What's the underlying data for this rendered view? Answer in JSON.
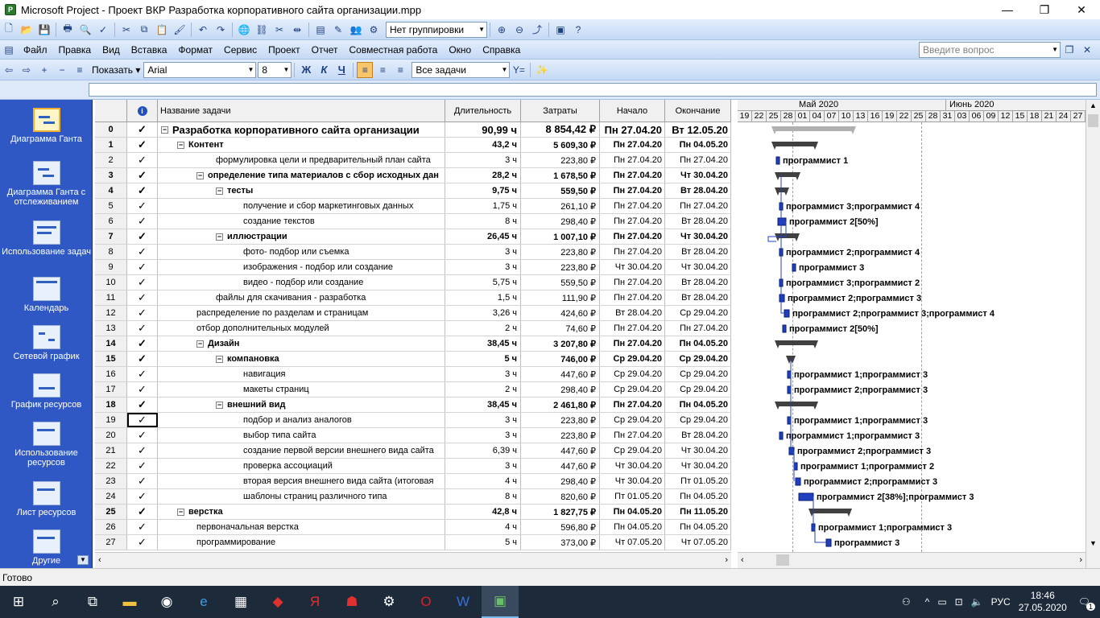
{
  "window": {
    "title": "Microsoft Project - Проект ВКР Разработка корпоративного сайта организации.mpp",
    "minimize": "—",
    "maximize": "❐",
    "close": "✕"
  },
  "toolbar1": {
    "grouping": "Нет группировки"
  },
  "menu": {
    "items": [
      "Файл",
      "Правка",
      "Вид",
      "Вставка",
      "Формат",
      "Сервис",
      "Проект",
      "Отчет",
      "Совместная работа",
      "Окно",
      "Справка"
    ],
    "help_placeholder": "Введите вопрос"
  },
  "toolbar3": {
    "show_label": "Показать",
    "font": "Arial",
    "size": "8",
    "bold": "Ж",
    "italic": "К",
    "underline": "Ч",
    "filter": "Все задачи"
  },
  "viewbar": {
    "items": [
      "Диаграмма Ганта",
      "Диаграмма Ганта с отслеживанием",
      "Использование задач",
      "Календарь",
      "Сетевой график",
      "График ресурсов",
      "Использование ресурсов",
      "Лист ресурсов",
      "Другие"
    ]
  },
  "table": {
    "headers": {
      "info": "i",
      "name": "Название задачи",
      "duration": "Длительность",
      "cost": "Затраты",
      "start": "Начало",
      "finish": "Окончание"
    },
    "rows": [
      {
        "id": "0",
        "name": "Разработка корпоративного сайта организации",
        "duration": "90,99 ч",
        "cost": "8 854,42 ₽",
        "start": "Пн 27.04.20",
        "finish": "Вт 12.05.20"
      },
      {
        "id": "1",
        "name": "Контент",
        "duration": "43,2 ч",
        "cost": "5 609,30 ₽",
        "start": "Пн 27.04.20",
        "finish": "Пн 04.05.20"
      },
      {
        "id": "2",
        "name": "формулировка цели и предварительный план сайта",
        "duration": "3 ч",
        "cost": "223,80 ₽",
        "start": "Пн 27.04.20",
        "finish": "Пн 27.04.20"
      },
      {
        "id": "3",
        "name": "определение типа материалов с сбор исходных дан",
        "duration": "28,2 ч",
        "cost": "1 678,50 ₽",
        "start": "Пн 27.04.20",
        "finish": "Чт 30.04.20"
      },
      {
        "id": "4",
        "name": "тесты",
        "duration": "9,75 ч",
        "cost": "559,50 ₽",
        "start": "Пн 27.04.20",
        "finish": "Вт 28.04.20"
      },
      {
        "id": "5",
        "name": "получение и сбор маркетинговых данных",
        "duration": "1,75 ч",
        "cost": "261,10 ₽",
        "start": "Пн 27.04.20",
        "finish": "Пн 27.04.20"
      },
      {
        "id": "6",
        "name": "создание текстов",
        "duration": "8 ч",
        "cost": "298,40 ₽",
        "start": "Пн 27.04.20",
        "finish": "Вт 28.04.20"
      },
      {
        "id": "7",
        "name": "иллюстрации",
        "duration": "26,45 ч",
        "cost": "1 007,10 ₽",
        "start": "Пн 27.04.20",
        "finish": "Чт 30.04.20"
      },
      {
        "id": "8",
        "name": "фото- подбор или съемка",
        "duration": "3 ч",
        "cost": "223,80 ₽",
        "start": "Пн 27.04.20",
        "finish": "Вт 28.04.20"
      },
      {
        "id": "9",
        "name": "изображения - подбор или создание",
        "duration": "3 ч",
        "cost": "223,80 ₽",
        "start": "Чт 30.04.20",
        "finish": "Чт 30.04.20"
      },
      {
        "id": "10",
        "name": "видео - подбор или создание",
        "duration": "5,75 ч",
        "cost": "559,50 ₽",
        "start": "Пн 27.04.20",
        "finish": "Вт 28.04.20"
      },
      {
        "id": "11",
        "name": "файлы для скачивания - разработка",
        "duration": "1,5 ч",
        "cost": "111,90 ₽",
        "start": "Пн 27.04.20",
        "finish": "Вт 28.04.20"
      },
      {
        "id": "12",
        "name": "распределение по разделам и страницам",
        "duration": "3,26 ч",
        "cost": "424,60 ₽",
        "start": "Вт 28.04.20",
        "finish": "Ср 29.04.20"
      },
      {
        "id": "13",
        "name": "отбор дополнительных модулей",
        "duration": "2 ч",
        "cost": "74,60 ₽",
        "start": "Пн 27.04.20",
        "finish": "Пн 27.04.20"
      },
      {
        "id": "14",
        "name": "Дизайн",
        "duration": "38,45 ч",
        "cost": "3 207,80 ₽",
        "start": "Пн 27.04.20",
        "finish": "Пн 04.05.20"
      },
      {
        "id": "15",
        "name": "компановка",
        "duration": "5 ч",
        "cost": "746,00 ₽",
        "start": "Ср 29.04.20",
        "finish": "Ср 29.04.20"
      },
      {
        "id": "16",
        "name": "навигация",
        "duration": "3 ч",
        "cost": "447,60 ₽",
        "start": "Ср 29.04.20",
        "finish": "Ср 29.04.20"
      },
      {
        "id": "17",
        "name": "макеты страниц",
        "duration": "2 ч",
        "cost": "298,40 ₽",
        "start": "Ср 29.04.20",
        "finish": "Ср 29.04.20"
      },
      {
        "id": "18",
        "name": "внешний вид",
        "duration": "38,45 ч",
        "cost": "2 461,80 ₽",
        "start": "Пн 27.04.20",
        "finish": "Пн 04.05.20"
      },
      {
        "id": "19",
        "name": "подбор и анализ аналогов",
        "duration": "3 ч",
        "cost": "223,80 ₽",
        "start": "Ср 29.04.20",
        "finish": "Ср 29.04.20"
      },
      {
        "id": "20",
        "name": "выбор типа сайта",
        "duration": "3 ч",
        "cost": "223,80 ₽",
        "start": "Пн 27.04.20",
        "finish": "Вт 28.04.20"
      },
      {
        "id": "21",
        "name": "создание первой версии внешнего вида сайта",
        "duration": "6,39 ч",
        "cost": "447,60 ₽",
        "start": "Ср 29.04.20",
        "finish": "Чт 30.04.20"
      },
      {
        "id": "22",
        "name": "проверка ассоциаций",
        "duration": "3 ч",
        "cost": "447,60 ₽",
        "start": "Чт 30.04.20",
        "finish": "Чт 30.04.20"
      },
      {
        "id": "23",
        "name": "вторая версия внешнего вида сайта (итоговая",
        "duration": "4 ч",
        "cost": "298,40 ₽",
        "start": "Чт 30.04.20",
        "finish": "Пт 01.05.20"
      },
      {
        "id": "24",
        "name": "шаблоны страниц различного типа",
        "duration": "8 ч",
        "cost": "820,60 ₽",
        "start": "Пт 01.05.20",
        "finish": "Пн 04.05.20"
      },
      {
        "id": "25",
        "name": "верстка",
        "duration": "42,8 ч",
        "cost": "1 827,75 ₽",
        "start": "Пн 04.05.20",
        "finish": "Пн 11.05.20"
      },
      {
        "id": "26",
        "name": "первоначальная верстка",
        "duration": "4 ч",
        "cost": "596,80 ₽",
        "start": "Пн 04.05.20",
        "finish": "Пн 04.05.20"
      },
      {
        "id": "27",
        "name": "программирование",
        "duration": "5 ч",
        "cost": "373,00 ₽",
        "start": "Чт 07.05.20",
        "finish": "Чт 07.05.20"
      }
    ]
  },
  "gantt": {
    "months": [
      "Май 2020",
      "Июнь 2020"
    ],
    "days": [
      "19",
      "22",
      "25",
      "28",
      "01",
      "04",
      "07",
      "10",
      "13",
      "16",
      "19",
      "22",
      "25",
      "28",
      "31",
      "03",
      "06",
      "09",
      "12",
      "15",
      "18",
      "21",
      "24",
      "27"
    ],
    "labels": [
      {
        "row": 2,
        "text": "программист 1"
      },
      {
        "row": 5,
        "text": "программист 3;программист 4"
      },
      {
        "row": 6,
        "text": "программист 2[50%]"
      },
      {
        "row": 8,
        "text": "программист 2;программист 4"
      },
      {
        "row": 9,
        "text": "программист 3"
      },
      {
        "row": 10,
        "text": "программист 3;программист 2"
      },
      {
        "row": 11,
        "text": "программист 2;программист 3"
      },
      {
        "row": 12,
        "text": "программист 2;программист 3;программист 4"
      },
      {
        "row": 13,
        "text": "программист 2[50%]"
      },
      {
        "row": 16,
        "text": "программист 1;программист 3"
      },
      {
        "row": 17,
        "text": "программист 2;программист 3"
      },
      {
        "row": 19,
        "text": "программист 1;программист 3"
      },
      {
        "row": 20,
        "text": "программист 1;программист 3"
      },
      {
        "row": 21,
        "text": "программист 2;программист 3"
      },
      {
        "row": 22,
        "text": "программист 1;программист 2"
      },
      {
        "row": 23,
        "text": "программист 2;программист 3"
      },
      {
        "row": 24,
        "text": "программист 2[38%];программист 3"
      },
      {
        "row": 26,
        "text": "программист 1;программист 3"
      },
      {
        "row": 27,
        "text": "программист 3"
      }
    ]
  },
  "status": {
    "text": "Готово"
  },
  "taskbar": {
    "lang": "РУС",
    "time": "18:46",
    "date": "27.05.2020",
    "notifications": "1"
  },
  "colors": {
    "viewbar": "#2f58c4",
    "gantt_task": "#2040c0",
    "summary": "#404040"
  }
}
